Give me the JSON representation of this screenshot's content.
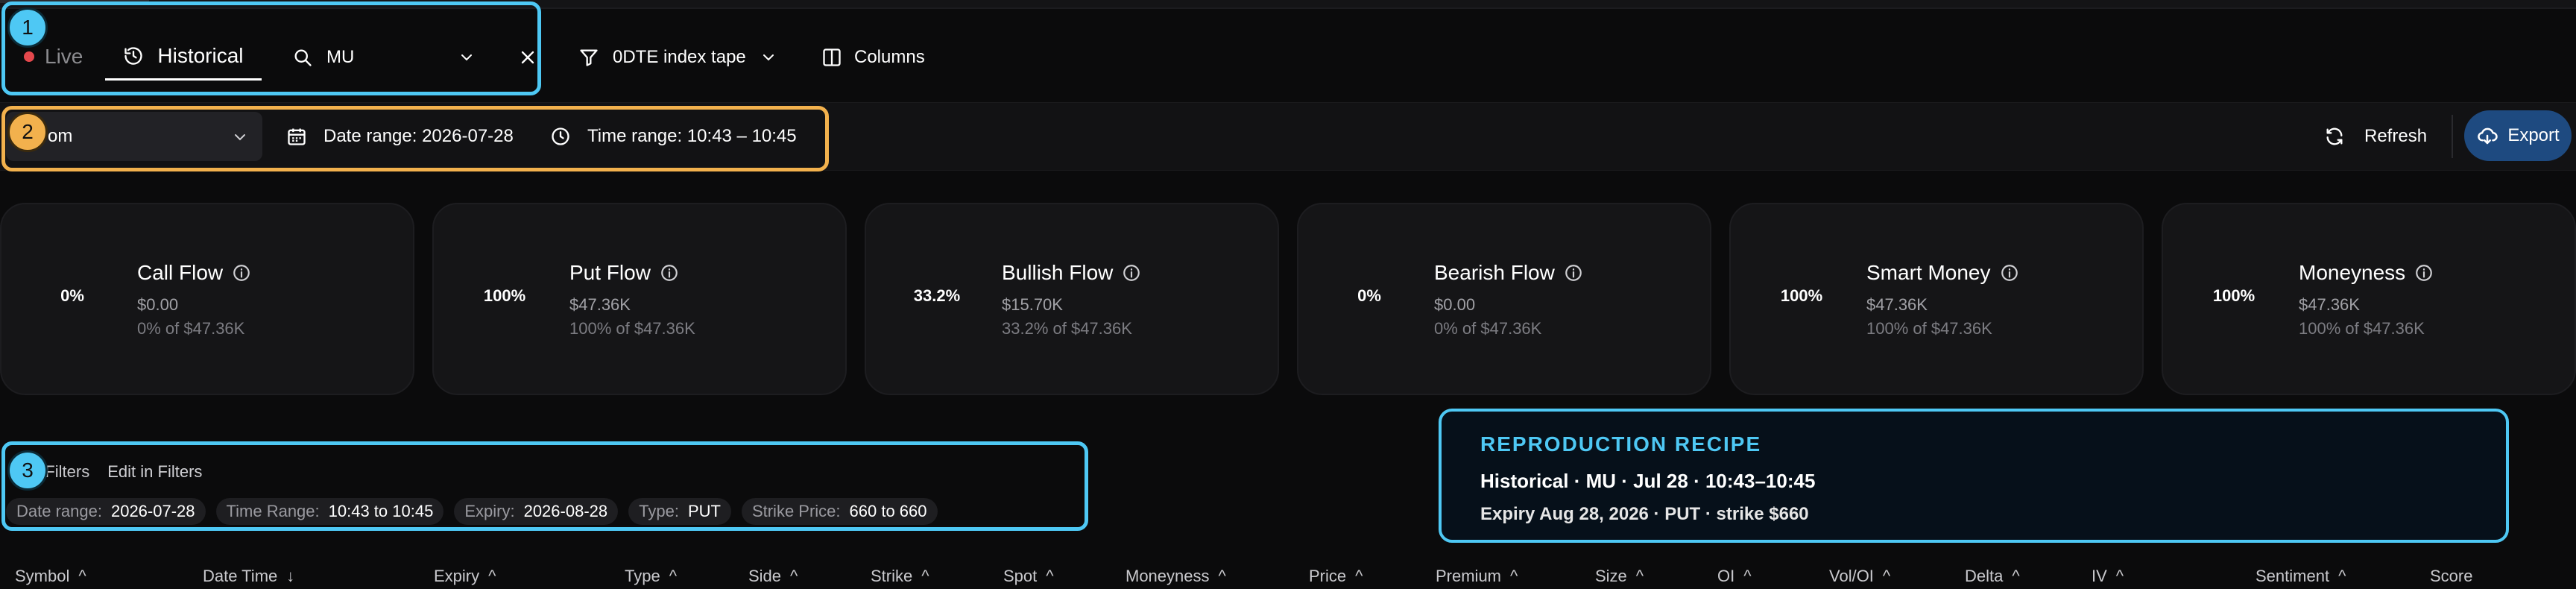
{
  "mode_tabs": {
    "live": "Live",
    "historical": "Historical"
  },
  "search": {
    "value": "MU"
  },
  "toolbar": {
    "tape": "0DTE index tape",
    "columns": "Columns"
  },
  "controls": {
    "select_value": "om",
    "date_range": "Date range: 2026-07-28",
    "time_range": "Time range: 10:43 – 10:45",
    "refresh": "Refresh",
    "export": "Export"
  },
  "cards": [
    {
      "pct": "0%",
      "title": "Call Flow",
      "amount": "$0.00",
      "sub": "0% of $47.36K"
    },
    {
      "pct": "100%",
      "title": "Put Flow",
      "amount": "$47.36K",
      "sub": "100% of $47.36K"
    },
    {
      "pct": "33.2%",
      "title": "Bullish Flow",
      "amount": "$15.70K",
      "sub": "33.2% of $47.36K"
    },
    {
      "pct": "0%",
      "title": "Bearish Flow",
      "amount": "$0.00",
      "sub": "0% of $47.36K"
    },
    {
      "pct": "100%",
      "title": "Smart Money",
      "amount": "$47.36K",
      "sub": "100% of $47.36K"
    },
    {
      "pct": "100%",
      "title": "Moneyness",
      "amount": "$47.36K",
      "sub": "100% of $47.36K"
    }
  ],
  "filters": {
    "applied": "d Filters",
    "edit": "Edit in Filters",
    "chips": [
      {
        "k": "Date range:",
        "v": "2026-07-28"
      },
      {
        "k": "Time Range:",
        "v": "10:43 to 10:45"
      },
      {
        "k": "Expiry:",
        "v": "2026-08-28"
      },
      {
        "k": "Type:",
        "v": "PUT"
      },
      {
        "k": "Strike Price:",
        "v": "660 to 660"
      }
    ]
  },
  "recipe": {
    "title": "REPRODUCTION RECIPE",
    "line1": "Historical · MU · Jul 28 · 10:43–10:45",
    "line2": "Expiry Aug 28, 2026 · PUT · strike $660"
  },
  "badges": [
    "1",
    "2",
    "3"
  ],
  "table": {
    "columns": [
      "Symbol",
      "Date Time",
      "Expiry",
      "Type",
      "Side",
      "Strike",
      "Spot",
      "Moneyness",
      "Price",
      "Premium",
      "Size",
      "OI",
      "Vol/OI",
      "Delta",
      "IV",
      "Sentiment",
      "Score"
    ]
  },
  "colors": {
    "accent": "#4ec8f4",
    "highlight2": "#f2b14d",
    "export_bg": "#1e4a80",
    "live_dot": "#e5484d"
  }
}
